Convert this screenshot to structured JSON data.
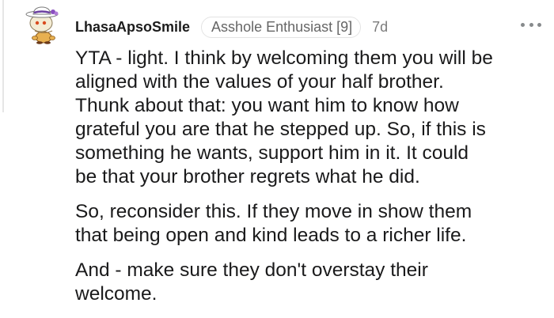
{
  "comment": {
    "author": "LhasaApsoSmile",
    "flair": "Asshole Enthusiast [9]",
    "timestamp": "7d",
    "avatar_icon": "snoo-avatar-icon",
    "more_icon": "more-options-icon",
    "paragraphs": [
      "YTA - light. I think by welcoming them you will be\naligned with the values of your half brother.\nThunk about that: you want him to know how\ngrateful you are that he stepped up. So, if this is\nsomething he wants, support him in it. It could\nbe that your brother regrets what he did.",
      "So, reconsider this. If they move in show them\nthat being open and kind leads to a richer life.",
      "And - make sure they don't overstay their\nwelcome."
    ]
  },
  "colors": {
    "flair_border": "#e3e3e3",
    "text": "#1a1a1b",
    "meta": "#7c7c7c"
  }
}
